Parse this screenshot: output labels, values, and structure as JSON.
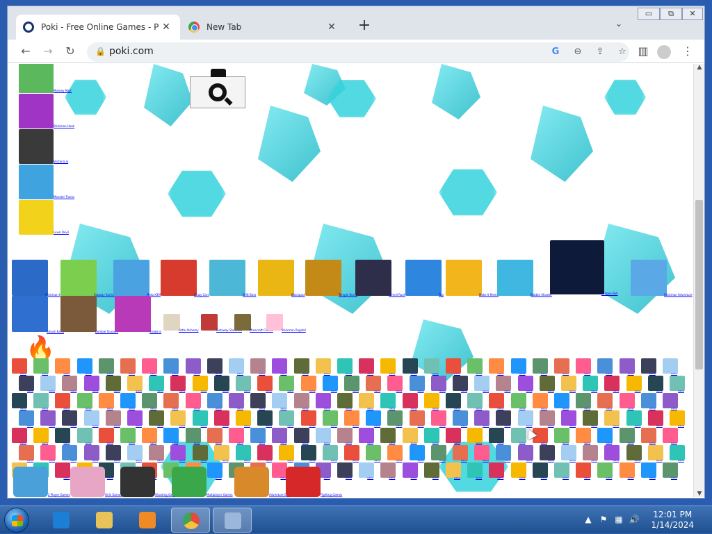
{
  "browser": {
    "tabs": [
      {
        "title": "Poki - Free Online Games - Play I",
        "active": true
      },
      {
        "title": "New Tab",
        "active": false
      }
    ],
    "new_tab_label": "+",
    "url": "poki.com",
    "window_controls": {
      "minimize": "▭",
      "restore": "⧉",
      "close": "✕"
    }
  },
  "page": {
    "sidebar_labels": [
      "Monkey Mart",
      "Stickman Hook",
      "Vectaria.io",
      "Monster Tracks",
      "Level Devil"
    ],
    "featured_row_1": [
      {
        "label": "Stickman Hook",
        "color": "#2b6ac7"
      },
      {
        "label": "Subway Surfers",
        "color": "#7ccf4e"
      },
      {
        "label": "Moto X3M",
        "color": "#4aa3e0"
      },
      {
        "label": "Crazy Cars",
        "color": "#d63b2e"
      },
      {
        "label": "Drift Boss",
        "color": "#4db7d8"
      },
      {
        "label": "Blockpost",
        "color": "#e9b614"
      },
      {
        "label": "Temple Run 2",
        "color": "#c48a18"
      },
      {
        "label": "Tunnel Rush",
        "color": "#2e2e4a"
      },
      {
        "label": "Tag",
        "color": "#2e86de"
      },
      {
        "label": "Make It Meme",
        "color": "#f3b51c"
      },
      {
        "label": "Bubble Shooter",
        "color": "#3fb7e0"
      },
      {
        "label": "Dragon Ball",
        "color": "#0d1a3a"
      },
      {
        "label": "Stickman Adventure",
        "color": "#5aa9e6"
      }
    ],
    "featured_row_2": [
      {
        "label": "Smash Karts",
        "color": "#2f6fcf"
      },
      {
        "label": "Zombie Tsunami",
        "color": "#7a5a3a"
      },
      {
        "label": "Snake.io",
        "color": "#b93ab8"
      },
      {
        "label": "Little Alchemy",
        "color": "#e0d5c0"
      },
      {
        "label": "Getaway Shootout",
        "color": "#c03a3a"
      },
      {
        "label": "Minecraft Classic",
        "color": "#7b6a3a"
      },
      {
        "label": "Stickman Ragdoll",
        "color": "#ffc0d8"
      }
    ],
    "grid_rows": 7,
    "grid_cols": 31,
    "grid_label": "Game",
    "categories": [
      {
        "label": "2 Player Games",
        "color": "#4aa0d8"
      },
      {
        "label": "Girls Games",
        "color": "#e8a6c6"
      },
      {
        "label": "Shooting Games",
        "color": "#333333"
      },
      {
        "label": "Multiplayer Games",
        "color": "#3aa84a"
      },
      {
        "label": "Adventure Games",
        "color": "#d88a2a"
      },
      {
        "label": "Fighting Games",
        "color": "#d62828"
      }
    ],
    "thumb_palette": [
      "#e94f3a",
      "#4a90d9",
      "#f2c14e",
      "#6abf69",
      "#8e5cc9",
      "#2ec4b6",
      "#ff8c42",
      "#3d405b",
      "#d8315b",
      "#1e96fc",
      "#a3cef1",
      "#f7b801",
      "#5c946e",
      "#b5838d",
      "#264653",
      "#e76f51",
      "#9d4edd",
      "#70c1b3",
      "#ff5d8f",
      "#606c38"
    ]
  },
  "taskbar": {
    "time": "12:01 PM",
    "date": "1/14/2024",
    "apps": [
      {
        "name": "internet-explorer",
        "color": "#1c7fd6",
        "active": false
      },
      {
        "name": "file-explorer",
        "color": "#e8c35a",
        "active": false
      },
      {
        "name": "media-player",
        "color": "#f08a24",
        "active": false
      },
      {
        "name": "chrome",
        "color": "#4285f4",
        "active": true
      },
      {
        "name": "on-screen-keyboard",
        "color": "#9cb7d9",
        "active": true
      }
    ]
  }
}
